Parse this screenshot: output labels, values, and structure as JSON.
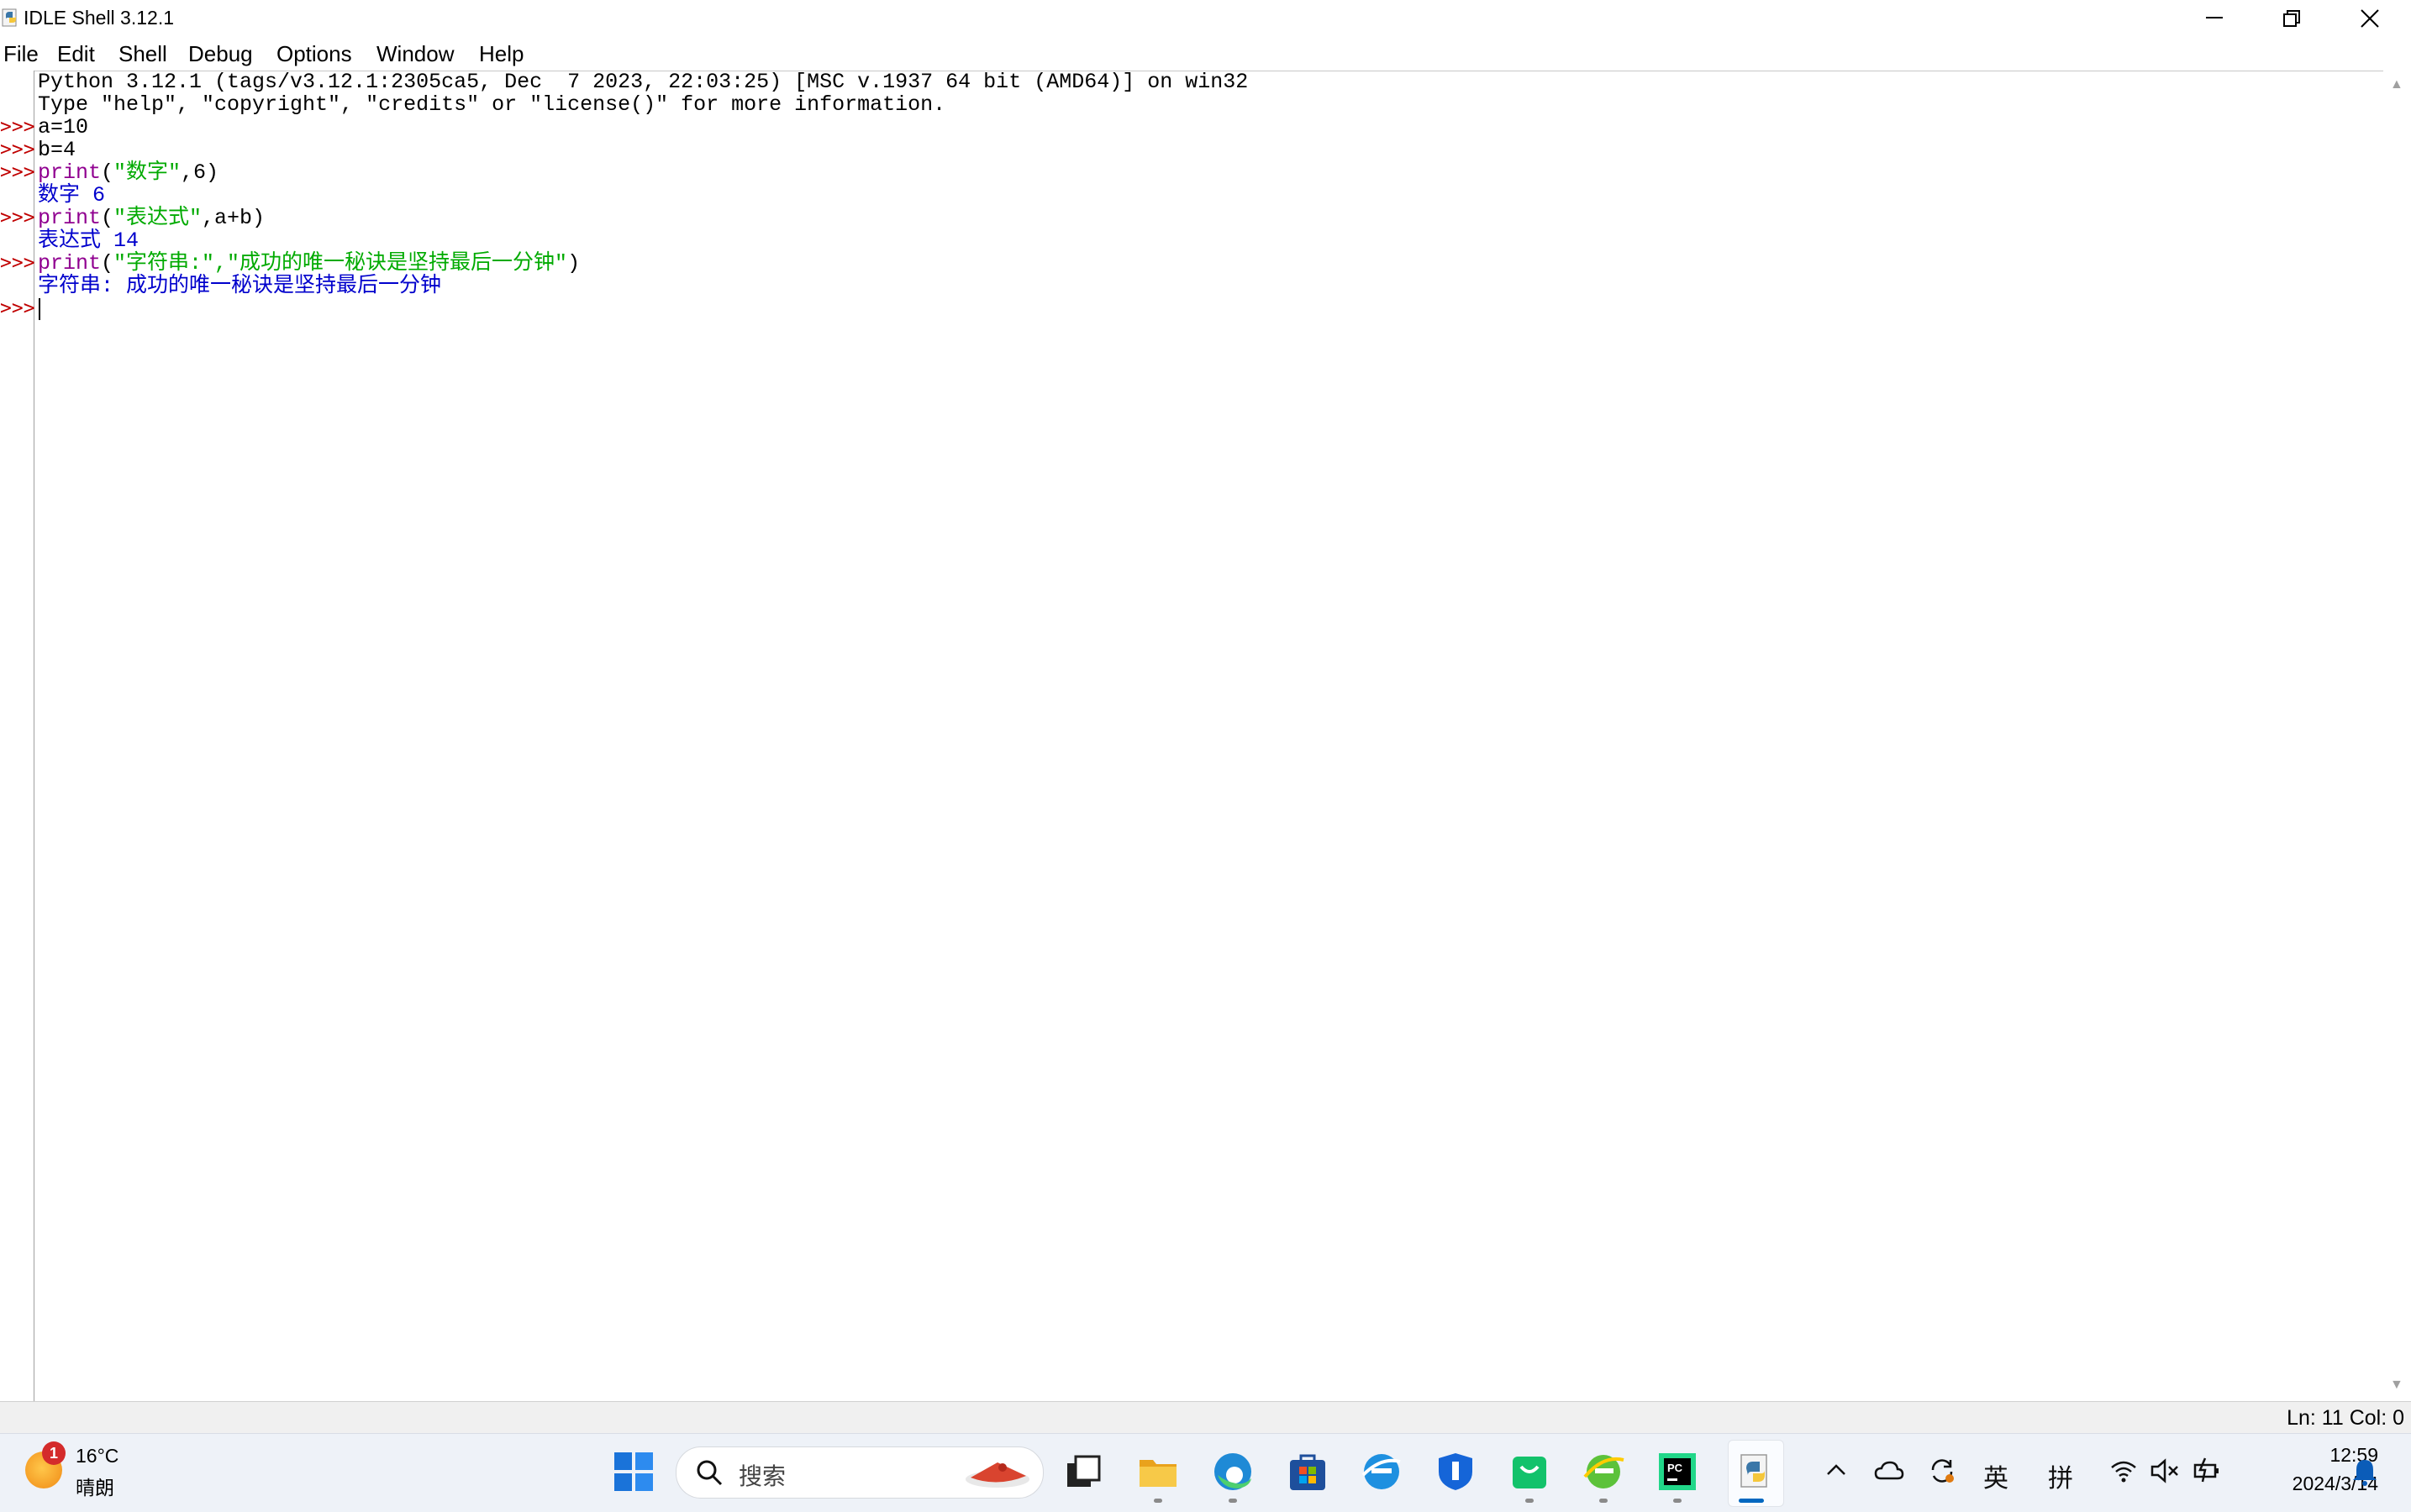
{
  "window": {
    "title": "IDLE Shell 3.12.1"
  },
  "menu": [
    "File",
    "Edit",
    "Shell",
    "Debug",
    "Options",
    "Window",
    "Help"
  ],
  "shell": {
    "prompt": ">>>",
    "banner1": "Python 3.12.1 (tags/v3.12.1:2305ca5, Dec  7 2023, 22:03:25) [MSC v.1937 64 bit (AMD64)] on win32",
    "banner2": "Type \"help\", \"copyright\", \"credits\" or \"license()\" for more information.",
    "in1": "a=10",
    "in2": "b=4",
    "in3_kw": "print",
    "in3_open": "(",
    "in3_str": "\"数字\"",
    "in3_rest": ",6)",
    "out3": "数字 6",
    "in4_kw": "print",
    "in4_open": "(",
    "in4_str": "\"表达式\"",
    "in4_rest": ",a+b)",
    "out4": "表达式 14",
    "in5_kw": "print",
    "in5_open": "(",
    "in5_str": "\"字符串:\",\"成功的唯一秘诀是坚持最后一分钟\"",
    "in5_rest": ")",
    "out5": "字符串: 成功的唯一秘诀是坚持最后一分钟"
  },
  "status": {
    "position": "Ln: 11  Col: 0"
  },
  "taskbar": {
    "weather_badge": "1",
    "weather_temp": "16°C",
    "weather_desc": "晴朗",
    "search_placeholder": "搜索",
    "tray_ime_en": "英",
    "tray_ime_pin": "拼",
    "clock_time": "12:59",
    "clock_date": "2024/3/14"
  },
  "colors": {
    "keyword": "#900090",
    "string": "#00aa00",
    "output": "#0000cc",
    "prompt": "#c00000",
    "taskbar_accent": "#0067c0"
  }
}
